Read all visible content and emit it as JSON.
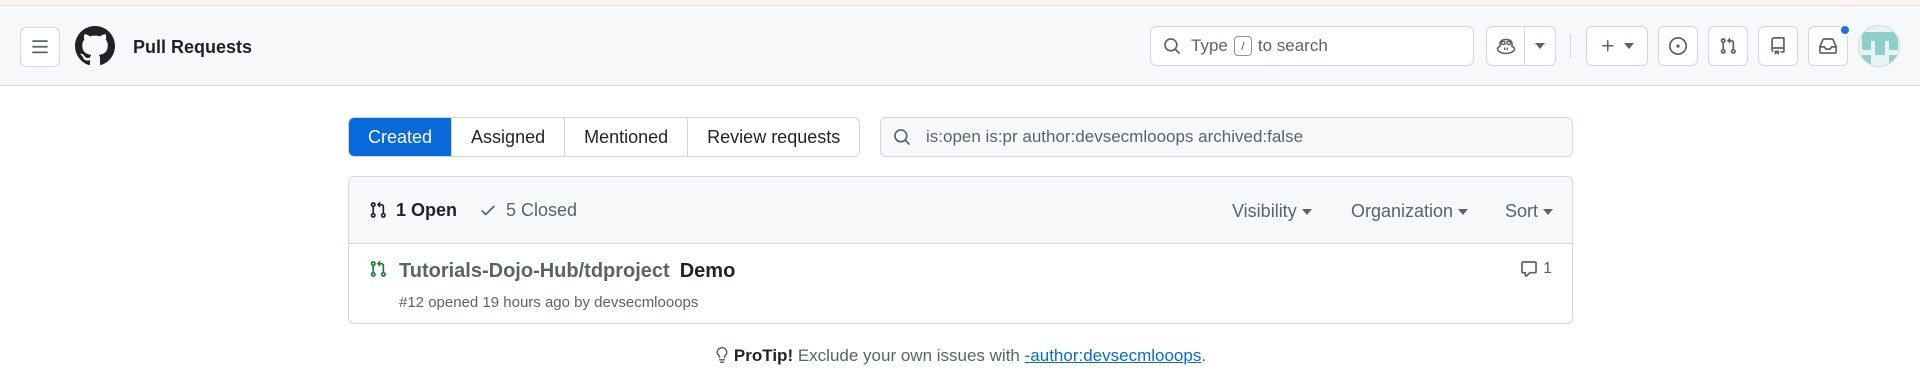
{
  "header": {
    "title": "Pull Requests",
    "search_prefix": "Type",
    "search_key": "/",
    "search_suffix": "to search"
  },
  "tabs": [
    {
      "label": "Created",
      "selected": true
    },
    {
      "label": "Assigned",
      "selected": false
    },
    {
      "label": "Mentioned",
      "selected": false
    },
    {
      "label": "Review requests",
      "selected": false
    }
  ],
  "filter": {
    "query": "is:open is:pr author:devsecmlooops archived:false"
  },
  "list": {
    "open_label": "1 Open",
    "closed_label": "5 Closed",
    "visibility_label": "Visibility",
    "organization_label": "Organization",
    "sort_label": "Sort",
    "items": [
      {
        "repo": "Tutorials-Dojo-Hub/tdproject",
        "title": "Demo",
        "meta": "#12 opened 19 hours ago by devsecmlooops",
        "comments": "1"
      }
    ]
  },
  "protip": {
    "label": "ProTip!",
    "text": "Exclude your own issues with",
    "link": "-author:devsecmlooops",
    "end": "."
  },
  "colors": {
    "accent": "#0969da",
    "open_green": "#1a7f37",
    "notification": "#1f6feb"
  }
}
